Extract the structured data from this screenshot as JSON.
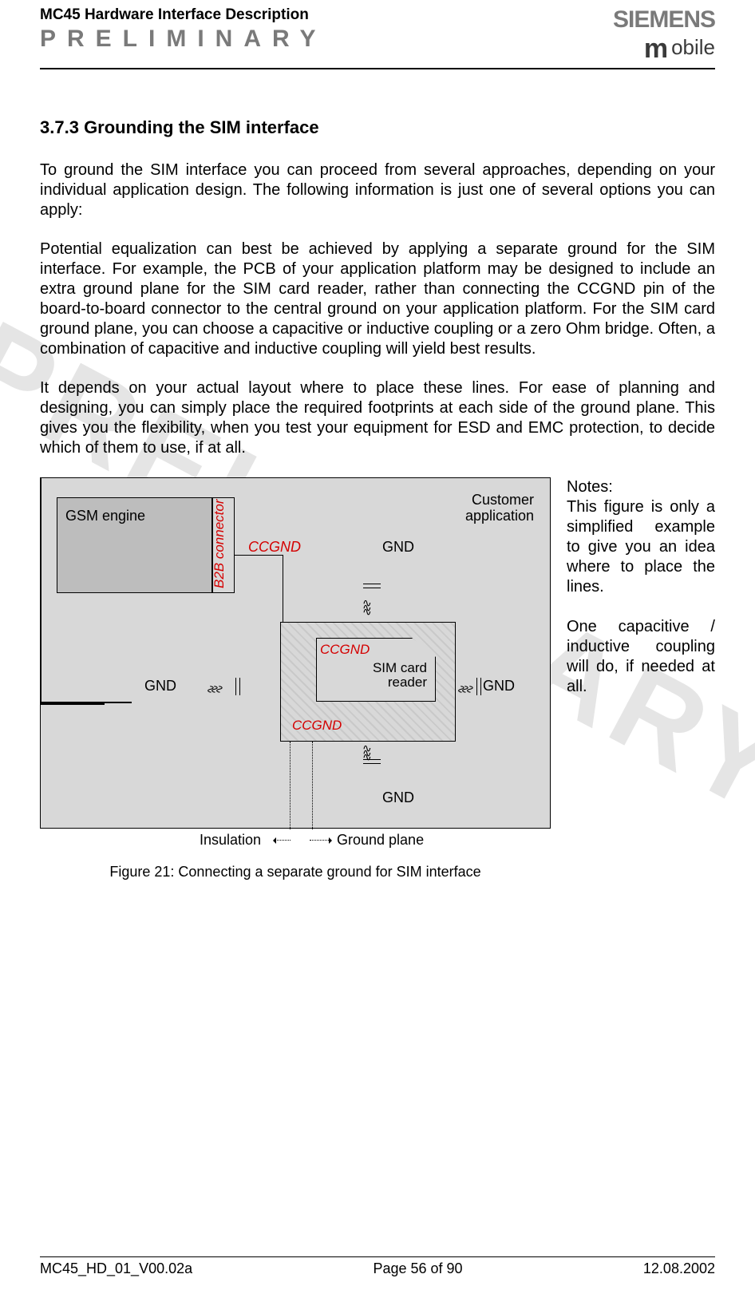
{
  "header": {
    "doc_title": "MC45 Hardware Interface Description",
    "preliminary": "PRELIMINARY",
    "brand": "SIEMENS",
    "subbrand": "obile"
  },
  "watermark": "PRELIMINARY",
  "section": {
    "number": "3.7.3",
    "title": "Grounding the SIM interface"
  },
  "paragraphs": {
    "p1": "To ground the SIM interface you can proceed from several approaches, depending on your individual application design. The following information is just one of several options you can apply:",
    "p2": "Potential equalization can best be achieved by applying a separate ground for the SIM interface. For example, the PCB of your application platform may be designed to include an extra ground plane for the SIM card reader, rather than connecting the CCGND pin of the board-to-board connector to the central ground on your application platform. For the SIM card ground plane, you can choose a capacitive or inductive coupling or a zero Ohm bridge. Often, a combination of capacitive and inductive coupling will yield best results.",
    "p3": "It depends on your actual layout where to place these lines. For ease of planning and designing, you can simply place the required footprints at each side of the ground plane. This gives you the flexibility, when you test your equipment for ESD and EMC protection, to decide which of them to use, if at all."
  },
  "notes": {
    "heading": "Notes:",
    "n1": "This figure is only a simplified example to give you an idea where to place the lines.",
    "n2": "One capacitive / inductive coupling will do, if needed at all."
  },
  "figure": {
    "gsm_engine": "GSM engine",
    "b2b": "B2B connector",
    "customer_app_l1": "Customer",
    "customer_app_l2": "application",
    "ccgnd": "CCGND",
    "gnd": "GND",
    "sim_reader_l1": "SIM card",
    "sim_reader_l2": "reader",
    "insulation": "Insulation",
    "ground_plane": "Ground plane",
    "caption": "Figure 21: Connecting a separate ground for SIM interface"
  },
  "footer": {
    "left": "MC45_HD_01_V00.02a",
    "center": "Page 56 of 90",
    "right": "12.08.2002"
  }
}
